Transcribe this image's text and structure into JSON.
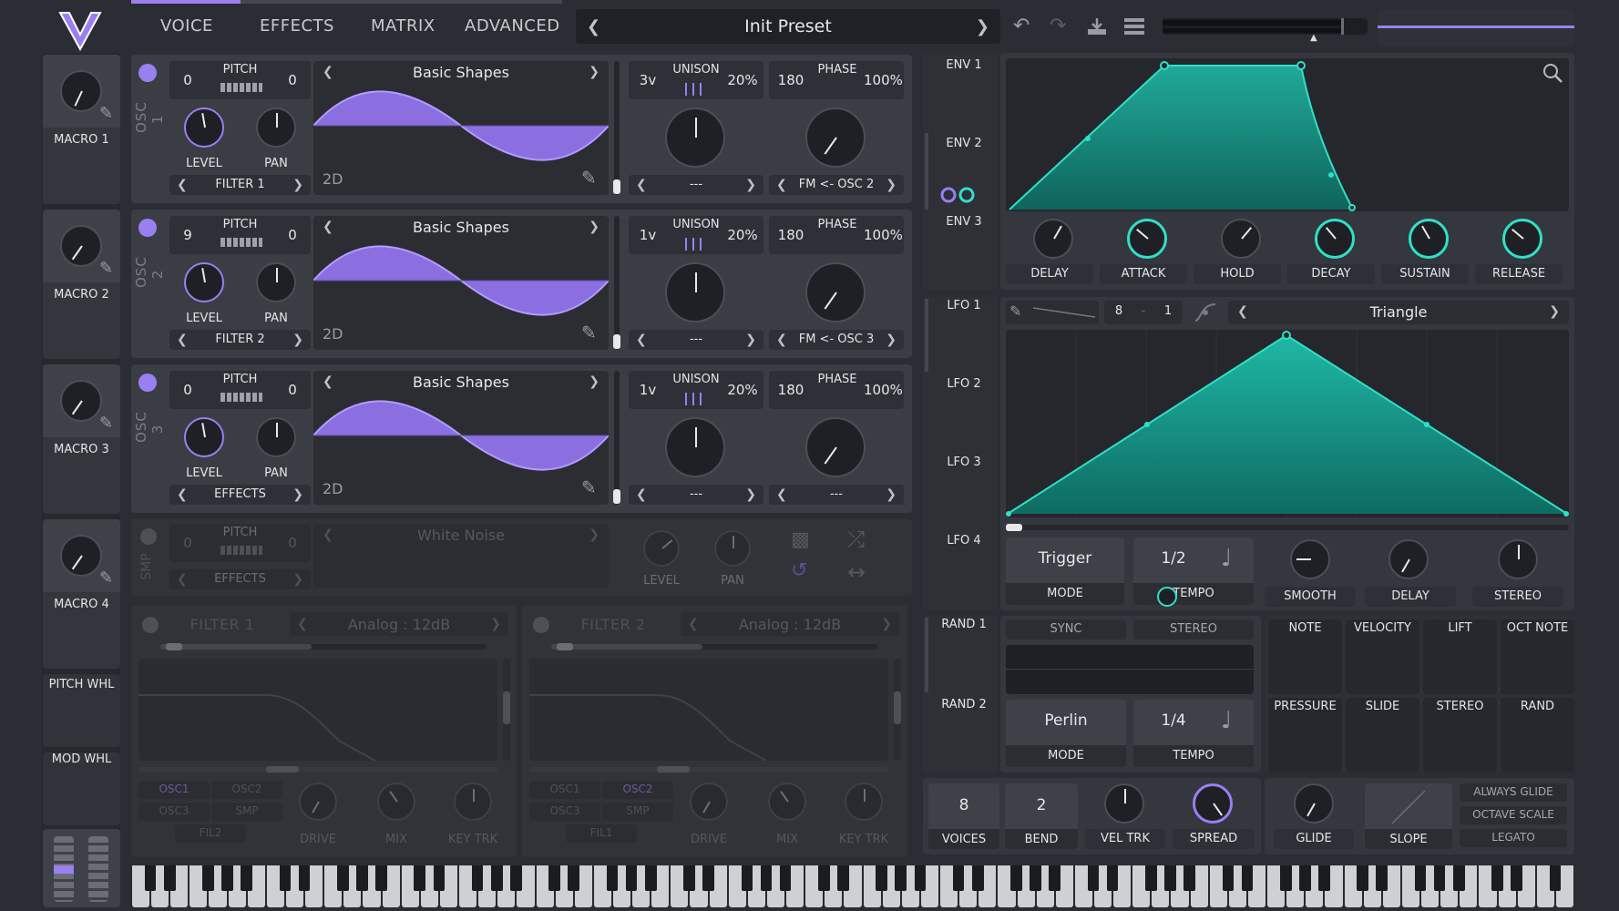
{
  "header": {
    "tabs": [
      "VOICE",
      "EFFECTS",
      "MATRIX",
      "ADVANCED"
    ],
    "preset": "Init Preset"
  },
  "macros": [
    "MACRO 1",
    "MACRO 2",
    "MACRO 3",
    "MACRO 4"
  ],
  "wheels": {
    "pitch": "PITCH WHL",
    "mod": "MOD WHL"
  },
  "osc": [
    {
      "name": "OSC 1",
      "pitch_l": "0",
      "pitch_r": "0",
      "wave": "Basic Shapes",
      "dim": "2D",
      "unison_v": "3v",
      "unison_pct": "20%",
      "phase": "180",
      "phase_pct": "100%",
      "route": "FILTER 1",
      "fm": "---",
      "fm2": "FM <- OSC 2"
    },
    {
      "name": "OSC 2",
      "pitch_l": "9",
      "pitch_r": "0",
      "wave": "Basic Shapes",
      "dim": "2D",
      "unison_v": "1v",
      "unison_pct": "20%",
      "phase": "180",
      "phase_pct": "100%",
      "route": "FILTER 2",
      "fm": "---",
      "fm2": "FM <- OSC 3"
    },
    {
      "name": "OSC 3",
      "pitch_l": "0",
      "pitch_r": "0",
      "wave": "Basic Shapes",
      "dim": "2D",
      "unison_v": "1v",
      "unison_pct": "20%",
      "phase": "180",
      "phase_pct": "100%",
      "route": "EFFECTS",
      "fm": "---",
      "fm2": "---"
    }
  ],
  "labels": {
    "pitch": "PITCH",
    "level": "LEVEL",
    "pan": "PAN",
    "unison": "UNISON",
    "phase": "PHASE"
  },
  "smp": {
    "name": "SMP",
    "pitch_l": "0",
    "pitch_r": "0",
    "wave": "White Noise",
    "route": "EFFECTS",
    "level": "LEVEL",
    "pan": "PAN"
  },
  "filters": [
    {
      "name": "FILTER 1",
      "type": "Analog : 12dB",
      "osc1": "OSC1",
      "osc2": "OSC2",
      "osc3": "OSC3",
      "smp": "SMP",
      "fil": "FIL2",
      "drive": "DRIVE",
      "mix": "MIX",
      "key": "KEY TRK"
    },
    {
      "name": "FILTER 2",
      "type": "Analog : 12dB",
      "osc1": "OSC1",
      "osc2": "OSC2",
      "osc3": "OSC3",
      "smp": "SMP",
      "fil": "FIL1",
      "drive": "DRIVE",
      "mix": "MIX",
      "key": "KEY TRK"
    }
  ],
  "env": {
    "tabs": [
      "ENV 1",
      "ENV 2",
      "ENV 3"
    ],
    "knobs": [
      "DELAY",
      "ATTACK",
      "HOLD",
      "DECAY",
      "SUSTAIN",
      "RELEASE"
    ]
  },
  "lfo": {
    "tabs": [
      "LFO 1",
      "LFO 2",
      "LFO 3",
      "LFO 4"
    ],
    "grid_a": "8",
    "grid_sep": "-",
    "grid_b": "1",
    "shape": "Triangle",
    "mode": "Trigger",
    "mode_lbl": "MODE",
    "tempo": "1/2",
    "tempo_lbl": "TEMPO",
    "smooth": "SMOOTH",
    "delay": "DELAY",
    "stereo": "STEREO"
  },
  "rand": {
    "tabs": [
      "RAND 1",
      "RAND 2"
    ],
    "sync": "SYNC",
    "stereo": "STEREO",
    "mode": "Perlin",
    "mode_lbl": "MODE",
    "tempo": "1/4",
    "tempo_lbl": "TEMPO"
  },
  "sources": {
    "row1": [
      "NOTE",
      "VELOCITY",
      "LIFT",
      "OCT NOTE"
    ],
    "row2": [
      "PRESSURE",
      "SLIDE",
      "STEREO",
      "RAND"
    ]
  },
  "voice": {
    "voices": "8",
    "voices_lbl": "VOICES",
    "bend": "2",
    "bend_lbl": "BEND",
    "veltrk": "VEL TRK",
    "spread": "SPREAD"
  },
  "glide": {
    "glide": "GLIDE",
    "slope": "SLOPE",
    "always": "ALWAYS GLIDE",
    "octave": "OCTAVE SCALE",
    "legato": "LEGATO"
  },
  "colors": {
    "purple": "#9a7ff0",
    "teal": "#2fe0c8",
    "bg": "#2a2d33"
  }
}
